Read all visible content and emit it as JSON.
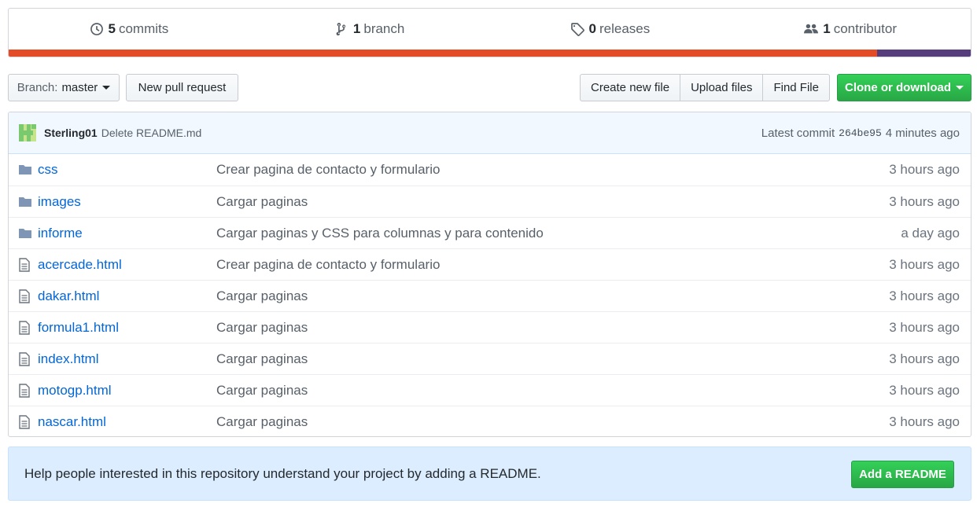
{
  "summary": {
    "commits": {
      "count": "5",
      "label": "commits",
      "icon": "history-icon"
    },
    "branches": {
      "count": "1",
      "label": "branch",
      "icon": "branch-icon"
    },
    "releases": {
      "count": "0",
      "label": "releases",
      "icon": "tag-icon"
    },
    "contributors": {
      "count": "1",
      "label": "contributor",
      "icon": "people-icon"
    }
  },
  "languages": [
    {
      "color": "#e34c26",
      "share": 0.903
    },
    {
      "color": "#563d7c",
      "share": 0.097
    }
  ],
  "toolbar": {
    "branch_prefix": "Branch:",
    "branch_name": "master",
    "new_pr": "New pull request",
    "create_file": "Create new file",
    "upload_files": "Upload files",
    "find_file": "Find File",
    "clone": "Clone or download"
  },
  "commit": {
    "author": "Sterling01",
    "message": "Delete README.md",
    "latest_label": "Latest commit",
    "sha": "264be95",
    "age": "4 minutes ago"
  },
  "files": [
    {
      "type": "dir",
      "name": "css",
      "message": "Crear pagina de contacto y formulario",
      "age": "3 hours ago"
    },
    {
      "type": "dir",
      "name": "images",
      "message": "Cargar paginas",
      "age": "3 hours ago"
    },
    {
      "type": "dir",
      "name": "informe",
      "message": "Cargar paginas y CSS para columnas y para contenido",
      "age": "a day ago"
    },
    {
      "type": "file",
      "name": "acercade.html",
      "message": "Crear pagina de contacto y formulario",
      "age": "3 hours ago"
    },
    {
      "type": "file",
      "name": "dakar.html",
      "message": "Cargar paginas",
      "age": "3 hours ago"
    },
    {
      "type": "file",
      "name": "formula1.html",
      "message": "Cargar paginas",
      "age": "3 hours ago"
    },
    {
      "type": "file",
      "name": "index.html",
      "message": "Cargar paginas",
      "age": "3 hours ago"
    },
    {
      "type": "file",
      "name": "motogp.html",
      "message": "Cargar paginas",
      "age": "3 hours ago"
    },
    {
      "type": "file",
      "name": "nascar.html",
      "message": "Cargar paginas",
      "age": "3 hours ago"
    }
  ],
  "readme": {
    "text": "Help people interested in this repository understand your project by adding a README.",
    "button": "Add a README"
  }
}
